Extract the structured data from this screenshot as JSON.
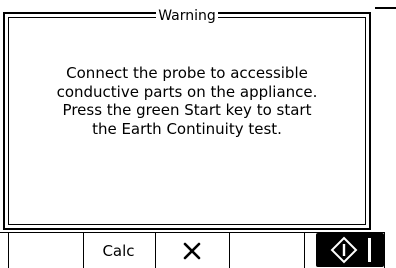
{
  "dialog": {
    "title": "Warning",
    "message_lines": [
      "Connect the probe to accessible",
      "conductive parts on the appliance.",
      "Press the green Start key to start",
      "the Earth Continuity test."
    ]
  },
  "softkeys": {
    "calc_label": "Calc",
    "close_icon": "close-icon",
    "start_icon": "start-icon"
  }
}
